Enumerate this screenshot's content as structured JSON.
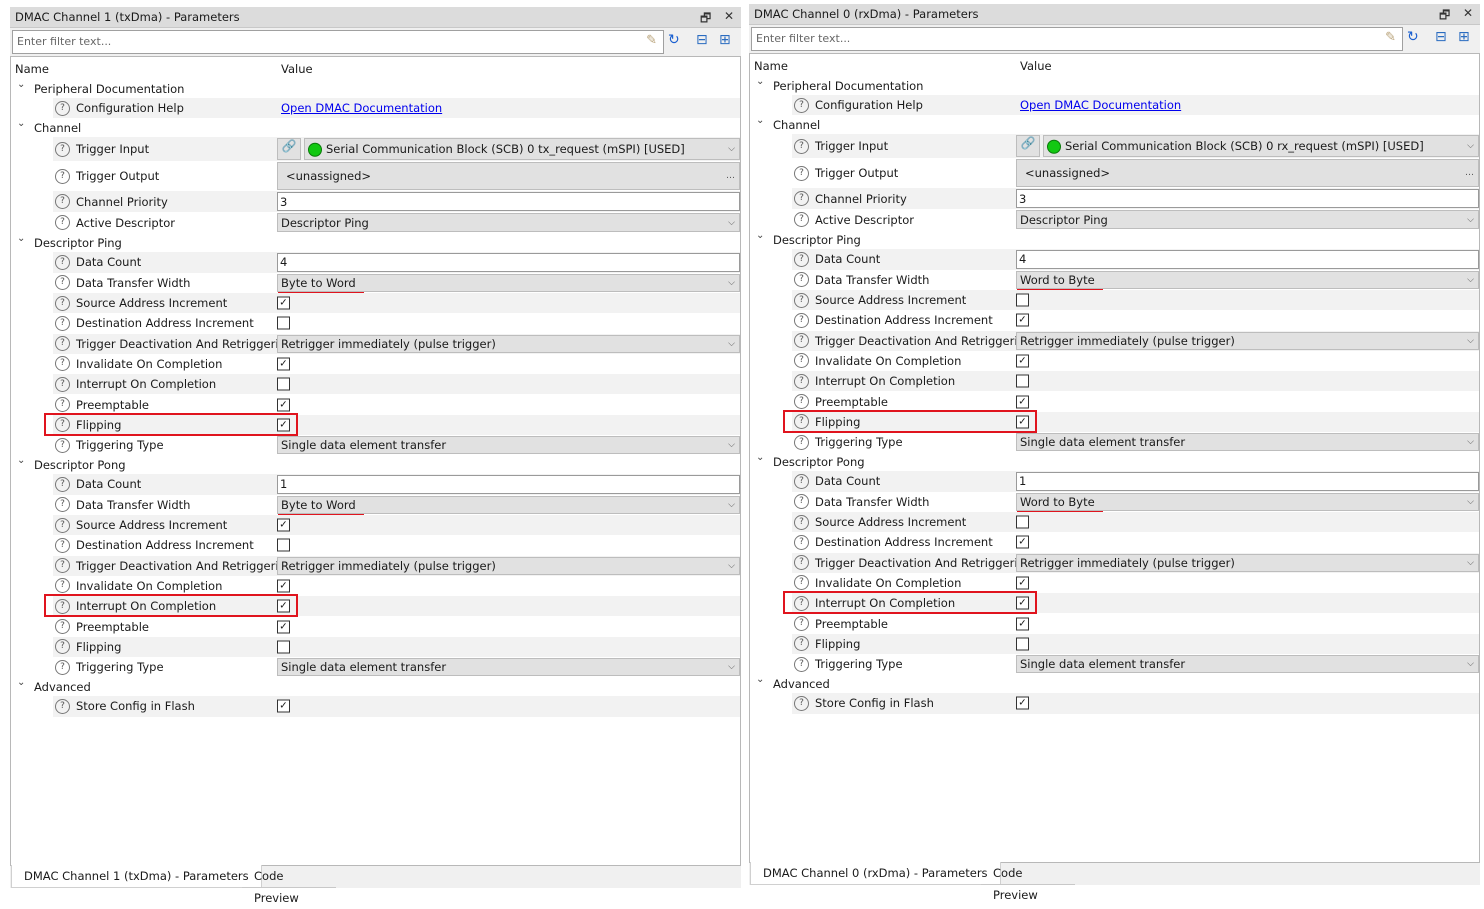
{
  "panels": [
    {
      "title": "DMAC Channel 1 (txDma) - Parameters",
      "filter_placeholder": "Enter filter text...",
      "col_name": "Name",
      "col_value": "Value",
      "tabs": [
        "DMAC Channel 1 (txDma) - Parameters",
        "Code Preview"
      ],
      "groups": [
        {
          "label": "Peripheral Documentation",
          "rows": [
            {
              "label": "Configuration Help",
              "type": "link",
              "value": "Open DMAC Documentation"
            }
          ]
        },
        {
          "label": "Channel",
          "rows": [
            {
              "label": "Trigger Input",
              "type": "trigger",
              "value": "Serial Communication Block (SCB) 0 tx_request (mSPI) [USED]",
              "status_color": "#12c812"
            },
            {
              "label": "Trigger Output",
              "type": "ellipsis",
              "value": "<unassigned>"
            },
            {
              "label": "Channel Priority",
              "type": "text",
              "value": "3"
            },
            {
              "label": "Active Descriptor",
              "type": "combo",
              "value": "Descriptor Ping"
            }
          ]
        },
        {
          "label": "Descriptor Ping",
          "rows": [
            {
              "label": "Data Count",
              "type": "text",
              "value": "4"
            },
            {
              "label": "Data Transfer Width",
              "type": "combo",
              "value": "Byte to Word",
              "underlined": true
            },
            {
              "label": "Source Address Increment",
              "type": "check",
              "checked": true
            },
            {
              "label": "Destination Address Increment",
              "type": "check",
              "checked": false
            },
            {
              "label": "Trigger Deactivation And Retriggering",
              "type": "combo",
              "value": "Retrigger immediately (pulse trigger)"
            },
            {
              "label": "Invalidate On Completion",
              "type": "check",
              "checked": true
            },
            {
              "label": "Interrupt On Completion",
              "type": "check",
              "checked": false
            },
            {
              "label": "Preemptable",
              "type": "check",
              "checked": true
            },
            {
              "label": "Flipping",
              "type": "check",
              "checked": true,
              "highlighted": true
            },
            {
              "label": "Triggering Type",
              "type": "combo",
              "value": "Single data element transfer"
            }
          ]
        },
        {
          "label": "Descriptor Pong",
          "rows": [
            {
              "label": "Data Count",
              "type": "text",
              "value": "1"
            },
            {
              "label": "Data Transfer Width",
              "type": "combo",
              "value": "Byte to Word",
              "underlined": true
            },
            {
              "label": "Source Address Increment",
              "type": "check",
              "checked": true
            },
            {
              "label": "Destination Address Increment",
              "type": "check",
              "checked": false
            },
            {
              "label": "Trigger Deactivation And Retriggering",
              "type": "combo",
              "value": "Retrigger immediately (pulse trigger)"
            },
            {
              "label": "Invalidate On Completion",
              "type": "check",
              "checked": true
            },
            {
              "label": "Interrupt On Completion",
              "type": "check",
              "checked": true,
              "highlighted": true
            },
            {
              "label": "Preemptable",
              "type": "check",
              "checked": true
            },
            {
              "label": "Flipping",
              "type": "check",
              "checked": false
            },
            {
              "label": "Triggering Type",
              "type": "combo",
              "value": "Single data element transfer"
            }
          ]
        },
        {
          "label": "Advanced",
          "rows": [
            {
              "label": "Store Config in Flash",
              "type": "check",
              "checked": true
            }
          ]
        }
      ]
    },
    {
      "title": "DMAC Channel 0 (rxDma) - Parameters",
      "filter_placeholder": "Enter filter text...",
      "col_name": "Name",
      "col_value": "Value",
      "tabs": [
        "DMAC Channel 0 (rxDma) - Parameters",
        "Code Preview"
      ],
      "groups": [
        {
          "label": "Peripheral Documentation",
          "rows": [
            {
              "label": "Configuration Help",
              "type": "link",
              "value": "Open DMAC Documentation"
            }
          ]
        },
        {
          "label": "Channel",
          "rows": [
            {
              "label": "Trigger Input",
              "type": "trigger",
              "value": "Serial Communication Block (SCB) 0 rx_request (mSPI) [USED]",
              "status_color": "#12c812"
            },
            {
              "label": "Trigger Output",
              "type": "ellipsis",
              "value": "<unassigned>"
            },
            {
              "label": "Channel Priority",
              "type": "text",
              "value": "3"
            },
            {
              "label": "Active Descriptor",
              "type": "combo",
              "value": "Descriptor Ping"
            }
          ]
        },
        {
          "label": "Descriptor Ping",
          "rows": [
            {
              "label": "Data Count",
              "type": "text",
              "value": "4"
            },
            {
              "label": "Data Transfer Width",
              "type": "combo",
              "value": "Word to Byte",
              "underlined": true
            },
            {
              "label": "Source Address Increment",
              "type": "check",
              "checked": false
            },
            {
              "label": "Destination Address Increment",
              "type": "check",
              "checked": true
            },
            {
              "label": "Trigger Deactivation And Retriggering",
              "type": "combo",
              "value": "Retrigger immediately (pulse trigger)"
            },
            {
              "label": "Invalidate On Completion",
              "type": "check",
              "checked": true
            },
            {
              "label": "Interrupt On Completion",
              "type": "check",
              "checked": false
            },
            {
              "label": "Preemptable",
              "type": "check",
              "checked": true
            },
            {
              "label": "Flipping",
              "type": "check",
              "checked": true,
              "highlighted": true
            },
            {
              "label": "Triggering Type",
              "type": "combo",
              "value": "Single data element transfer"
            }
          ]
        },
        {
          "label": "Descriptor Pong",
          "rows": [
            {
              "label": "Data Count",
              "type": "text",
              "value": "1"
            },
            {
              "label": "Data Transfer Width",
              "type": "combo",
              "value": "Word to Byte",
              "underlined": true
            },
            {
              "label": "Source Address Increment",
              "type": "check",
              "checked": false
            },
            {
              "label": "Destination Address Increment",
              "type": "check",
              "checked": true
            },
            {
              "label": "Trigger Deactivation And Retriggering",
              "type": "combo",
              "value": "Retrigger immediately (pulse trigger)"
            },
            {
              "label": "Invalidate On Completion",
              "type": "check",
              "checked": true
            },
            {
              "label": "Interrupt On Completion",
              "type": "check",
              "checked": true,
              "highlighted": true
            },
            {
              "label": "Preemptable",
              "type": "check",
              "checked": true
            },
            {
              "label": "Flipping",
              "type": "check",
              "checked": false
            },
            {
              "label": "Triggering Type",
              "type": "combo",
              "value": "Single data element transfer"
            }
          ]
        },
        {
          "label": "Advanced",
          "rows": [
            {
              "label": "Store Config in Flash",
              "type": "check",
              "checked": true
            }
          ]
        }
      ]
    }
  ],
  "icons": {
    "restore": "restore-window-icon",
    "close": "close-icon",
    "eraser": "eraser-icon",
    "refresh": "refresh-icon",
    "collapse": "collapse-all-icon",
    "expand": "expand-all-icon",
    "help": "help-icon",
    "link": "link-icon"
  },
  "colors": {
    "highlight": "#e0141e",
    "link": "#0000ee",
    "status_ok": "#12c812"
  }
}
